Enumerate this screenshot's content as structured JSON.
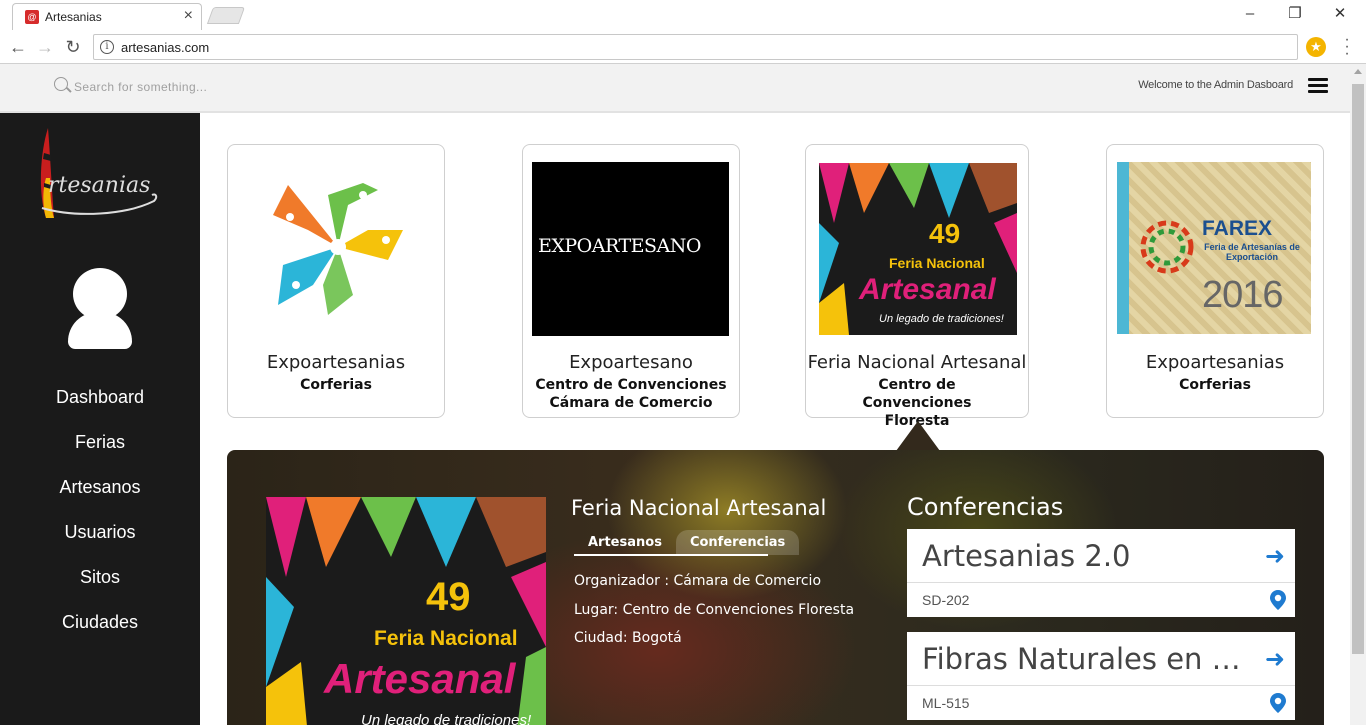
{
  "browser": {
    "tab_title": "Artesanias",
    "url": "artesanias.com"
  },
  "topbar": {
    "search_placeholder": "Search for something...",
    "welcome": "Welcome to the Admin Dasboard"
  },
  "sidebar": {
    "logo_text": "rtesanias",
    "items": [
      {
        "label": "Dashboard"
      },
      {
        "label": "Ferias"
      },
      {
        "label": "Artesanos"
      },
      {
        "label": "Usuarios"
      },
      {
        "label": "Sitos"
      },
      {
        "label": "Ciudades"
      }
    ]
  },
  "fairs": [
    {
      "title": "Expoartesanias",
      "venue": "Corferias",
      "image_text": ""
    },
    {
      "title": "Expoartesano",
      "venue": "Centro de Convenciones Cámara de Comercio",
      "image_text": "EXPOARTESANO"
    },
    {
      "title": "Feria Nacional Artesanal",
      "venue": "Centro de Convenciones Floresta",
      "image_text": "49 Feria Nacional Artesanal"
    },
    {
      "title": "Expoartesanias",
      "venue": "Corferias",
      "image_text": "FAREX Feria de Artesanías de Exportación 2016"
    }
  ],
  "detail": {
    "title": "Feria Nacional Artesanal",
    "tabs": [
      {
        "label": "Artesanos"
      },
      {
        "label": "Conferencias"
      }
    ],
    "organizer": "Organizador : Cámara de Comercio",
    "place": "Lugar: Centro de Convenciones Floresta",
    "city": "Ciudad: Bogotá",
    "poster": {
      "number": "49",
      "line1": "Feria Nacional",
      "line2": "Artesanal",
      "tagline": "Un legado de tradiciones!"
    },
    "conferences_heading": "Conferencias",
    "conferences": [
      {
        "name": "Artesanias 2.0",
        "room": "SD-202"
      },
      {
        "name": "Fibras Naturales en Artesanias",
        "room": "ML-515"
      }
    ]
  },
  "colors": {
    "sidebar_bg": "#1a1a1a",
    "accent_blue": "#1f7bd0",
    "expo_orange": "#f07a2a",
    "expo_green": "#6cc04a",
    "expo_yellow": "#f5c20b",
    "expo_cyan": "#2bb5d8"
  }
}
